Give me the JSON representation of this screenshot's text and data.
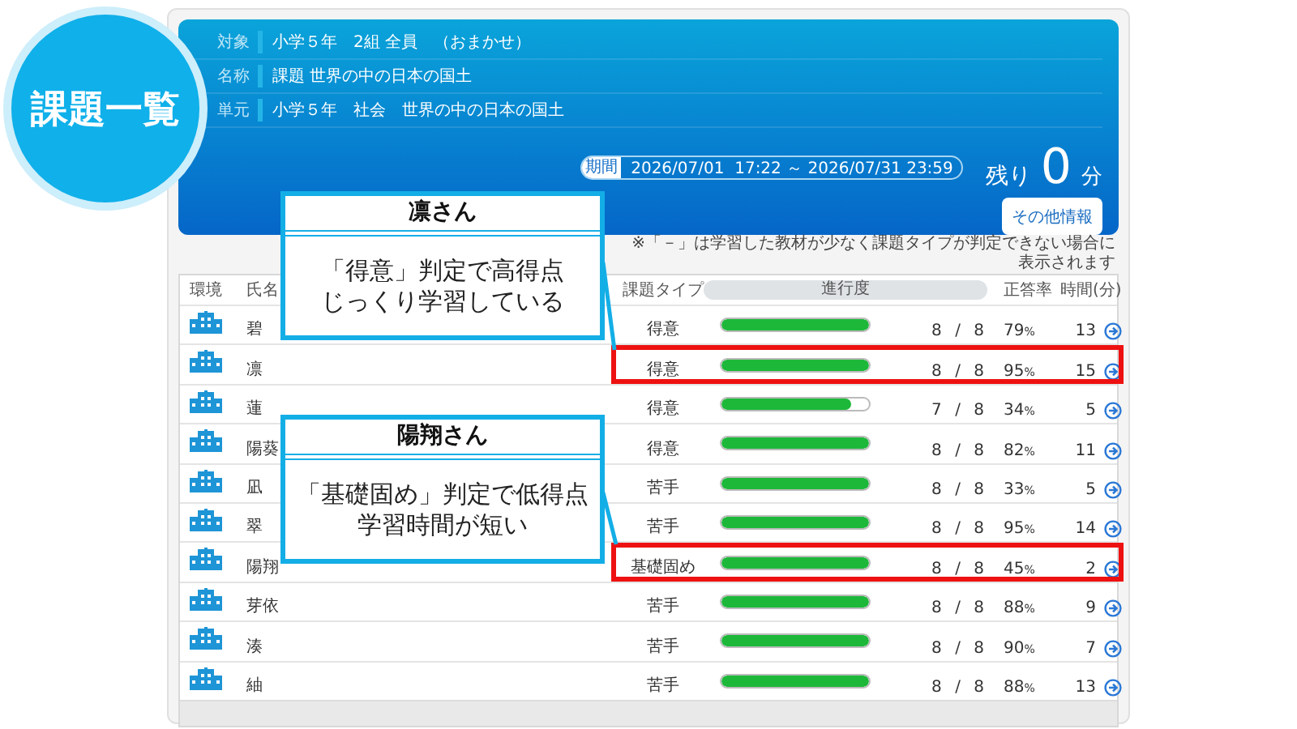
{
  "title_badge": "課題一覧",
  "header": {
    "info": [
      {
        "label": "対象",
        "value": "小学５年　2組 全員　（おまかせ）"
      },
      {
        "label": "名称",
        "value": "課題 世界の中の日本の国土"
      },
      {
        "label": "単元",
        "value": "小学５年　社会　世界の中の日本の国土"
      }
    ],
    "period": {
      "label": "期間",
      "value": "2026/07/01  17:22 ～ 2026/07/31 23:59"
    },
    "remaining": {
      "prefix": "残り",
      "value": "0",
      "unit": "分"
    },
    "button": "その他情報"
  },
  "note": "※「－」は学習した教材が少なく課題タイプが判定できない場合に表示されます",
  "table": {
    "columns": [
      "環境",
      "氏名",
      "課題タイプ",
      "進行度",
      "正答率",
      "時間(分)"
    ],
    "rows": [
      {
        "name": "碧",
        "type": "得意",
        "level": 1,
        "count": "8 / 8",
        "rate": "79",
        "rate_unit": "%",
        "time": "13",
        "highlighted": false
      },
      {
        "name": "凛",
        "type": "得意",
        "level": 1,
        "count": "8 / 8",
        "rate": "95",
        "rate_unit": "%",
        "time": "15",
        "highlighted": true
      },
      {
        "name": "蓮",
        "type": "得意",
        "level": 0.875,
        "count": "7 / 8",
        "rate": "34",
        "rate_unit": "%",
        "time": "5",
        "highlighted": false
      },
      {
        "name": "陽葵",
        "type": "得意",
        "level": 1,
        "count": "8 / 8",
        "rate": "82",
        "rate_unit": "%",
        "time": "11",
        "highlighted": false
      },
      {
        "name": "凪",
        "type": "苦手",
        "level": 1,
        "count": "8 / 8",
        "rate": "33",
        "rate_unit": "%",
        "time": "5",
        "highlighted": false
      },
      {
        "name": "翠",
        "type": "苦手",
        "level": 1,
        "count": "8 / 8",
        "rate": "95",
        "rate_unit": "%",
        "time": "14",
        "highlighted": false
      },
      {
        "name": "陽翔",
        "type": "基礎固め",
        "level": 1,
        "count": "8 / 8",
        "rate": "45",
        "rate_unit": "%",
        "time": "2",
        "highlighted": true
      },
      {
        "name": "芽依",
        "type": "苦手",
        "level": 1,
        "count": "8 / 8",
        "rate": "88",
        "rate_unit": "%",
        "time": "9",
        "highlighted": false
      },
      {
        "name": "湊",
        "type": "苦手",
        "level": 1,
        "count": "8 / 8",
        "rate": "90",
        "rate_unit": "%",
        "time": "7",
        "highlighted": false
      },
      {
        "name": "紬",
        "type": "苦手",
        "level": 1,
        "count": "8 / 8",
        "rate": "88",
        "rate_unit": "%",
        "time": "13",
        "highlighted": false
      }
    ]
  },
  "callouts": [
    {
      "title": "凛さん",
      "lines": [
        "「得意」判定で高得点",
        "じっくり学習している"
      ]
    },
    {
      "title": "陽翔さん",
      "lines": [
        "「基礎固め」判定で低得点",
        "学習時間が短い"
      ]
    }
  ]
}
